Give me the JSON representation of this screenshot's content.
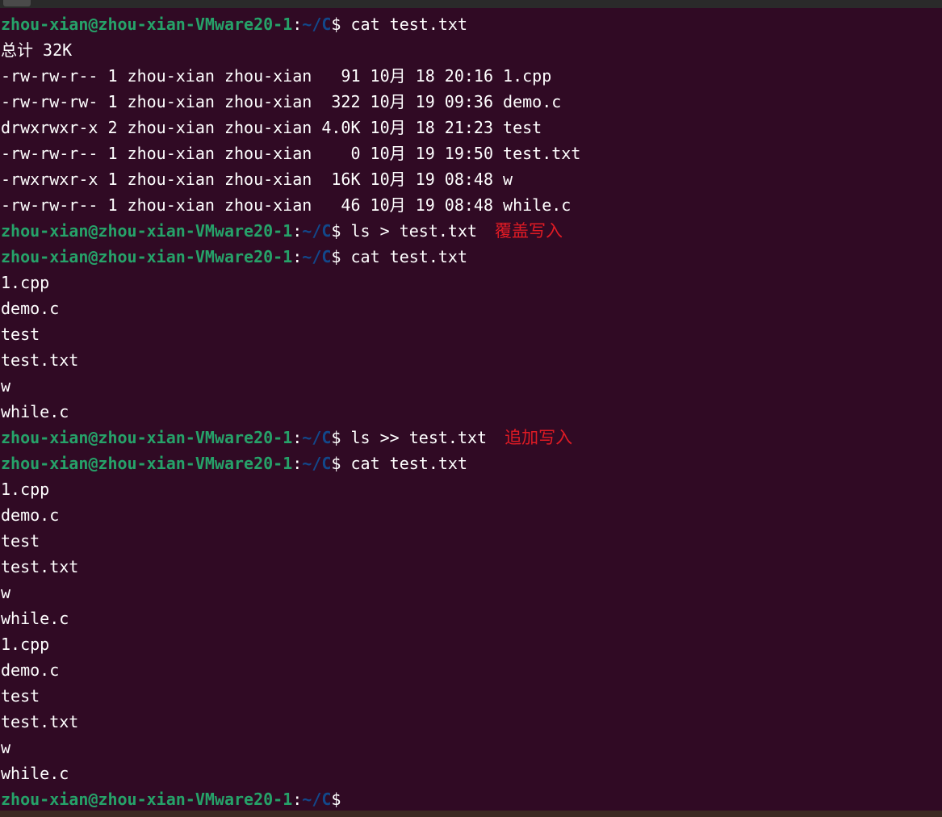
{
  "prompt": {
    "user_host": "zhou-xian@zhou-xian-VMware20-1",
    "colon": ":",
    "path": "~/C",
    "dollar": "$"
  },
  "colors": {
    "background": "#300a24",
    "prompt_user": "#26a269",
    "prompt_path": "#12488b",
    "annotation": "#e01b24",
    "text": "#ffffff"
  },
  "lines": [
    {
      "type": "prompt",
      "command": " cat test.txt"
    },
    {
      "type": "output",
      "text": "总计 32K"
    },
    {
      "type": "output",
      "text": "-rw-rw-r-- 1 zhou-xian zhou-xian   91 10月 18 20:16 1.cpp"
    },
    {
      "type": "output",
      "text": "-rw-rw-rw- 1 zhou-xian zhou-xian  322 10月 19 09:36 demo.c"
    },
    {
      "type": "output",
      "text": "drwxrwxr-x 2 zhou-xian zhou-xian 4.0K 10月 18 21:23 test"
    },
    {
      "type": "output",
      "text": "-rw-rw-r-- 1 zhou-xian zhou-xian    0 10月 19 19:50 test.txt"
    },
    {
      "type": "output",
      "text": "-rwxrwxr-x 1 zhou-xian zhou-xian  16K 10月 19 08:48 w"
    },
    {
      "type": "output",
      "text": "-rw-rw-r-- 1 zhou-xian zhou-xian   46 10月 19 08:48 while.c"
    },
    {
      "type": "prompt",
      "command": " ls > test.txt",
      "note": "覆盖写入"
    },
    {
      "type": "prompt",
      "command": " cat test.txt"
    },
    {
      "type": "output",
      "text": "1.cpp"
    },
    {
      "type": "output",
      "text": "demo.c"
    },
    {
      "type": "output",
      "text": "test"
    },
    {
      "type": "output",
      "text": "test.txt"
    },
    {
      "type": "output",
      "text": "w"
    },
    {
      "type": "output",
      "text": "while.c"
    },
    {
      "type": "prompt",
      "command": " ls >> test.txt",
      "note": "追加写入"
    },
    {
      "type": "prompt",
      "command": " cat test.txt"
    },
    {
      "type": "output",
      "text": "1.cpp"
    },
    {
      "type": "output",
      "text": "demo.c"
    },
    {
      "type": "output",
      "text": "test"
    },
    {
      "type": "output",
      "text": "test.txt"
    },
    {
      "type": "output",
      "text": "w"
    },
    {
      "type": "output",
      "text": "while.c"
    },
    {
      "type": "output",
      "text": "1.cpp"
    },
    {
      "type": "output",
      "text": "demo.c"
    },
    {
      "type": "output",
      "text": "test"
    },
    {
      "type": "output",
      "text": "test.txt"
    },
    {
      "type": "output",
      "text": "w"
    },
    {
      "type": "output",
      "text": "while.c"
    },
    {
      "type": "prompt",
      "command": ""
    }
  ]
}
